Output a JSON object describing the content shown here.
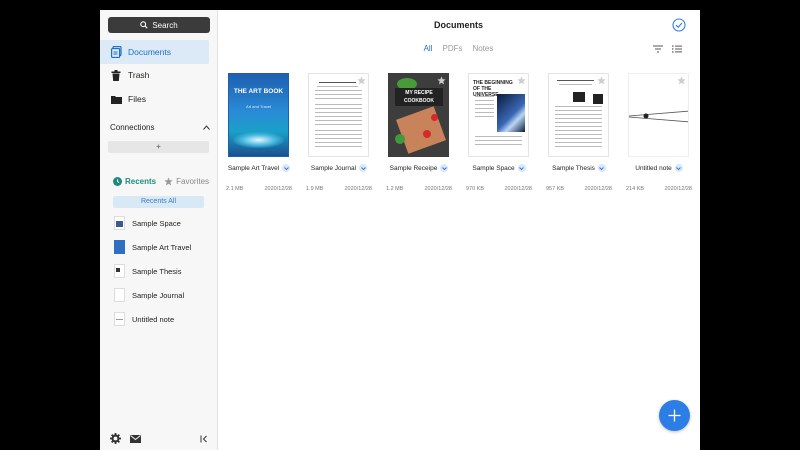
{
  "sidebar": {
    "search_label": "Search",
    "nav": [
      {
        "label": "Documents",
        "icon": "documents-icon",
        "active": true
      },
      {
        "label": "Trash",
        "icon": "trash-icon",
        "active": false
      },
      {
        "label": "Files",
        "icon": "folder-icon",
        "active": false
      }
    ],
    "connections_label": "Connections",
    "add_connection_label": "+",
    "recents_tab": "Recents",
    "favorites_tab": "Favorites",
    "recents_all_label": "Recents All",
    "recents": [
      {
        "label": "Sample Space"
      },
      {
        "label": "Sample Art Travel"
      },
      {
        "label": "Sample Thesis"
      },
      {
        "label": "Sample Journal"
      },
      {
        "label": "Untitled note"
      }
    ]
  },
  "main": {
    "title": "Documents",
    "tabs": [
      {
        "label": "All",
        "active": true
      },
      {
        "label": "PDFs",
        "active": false
      },
      {
        "label": "Notes",
        "active": false
      }
    ],
    "documents": [
      {
        "name": "Sample Art Travel",
        "size": "2.1 MB",
        "date": "2020/12/28",
        "cover_title": "THE ART BOOK",
        "cover_subtitle": "Art and Travel"
      },
      {
        "name": "Sample Journal",
        "size": "1.9 MB",
        "date": "2020/12/28"
      },
      {
        "name": "Sample Receipe",
        "size": "1.2 MB",
        "date": "2020/12/28",
        "cover_title": "MY RECIPE COOKBOOK"
      },
      {
        "name": "Sample Space",
        "size": "970 KB",
        "date": "2020/12/28",
        "cover_title": "THE BEGINNING OF THE UNIVERSE"
      },
      {
        "name": "Sample Thesis",
        "size": "957 KB",
        "date": "2020/12/28"
      },
      {
        "name": "Untitled note",
        "size": "214 KB",
        "date": "2020/12/28"
      }
    ]
  },
  "colors": {
    "accent": "#1d6fd1",
    "fab": "#2d7de6",
    "recents_green": "#1e8c7c"
  }
}
